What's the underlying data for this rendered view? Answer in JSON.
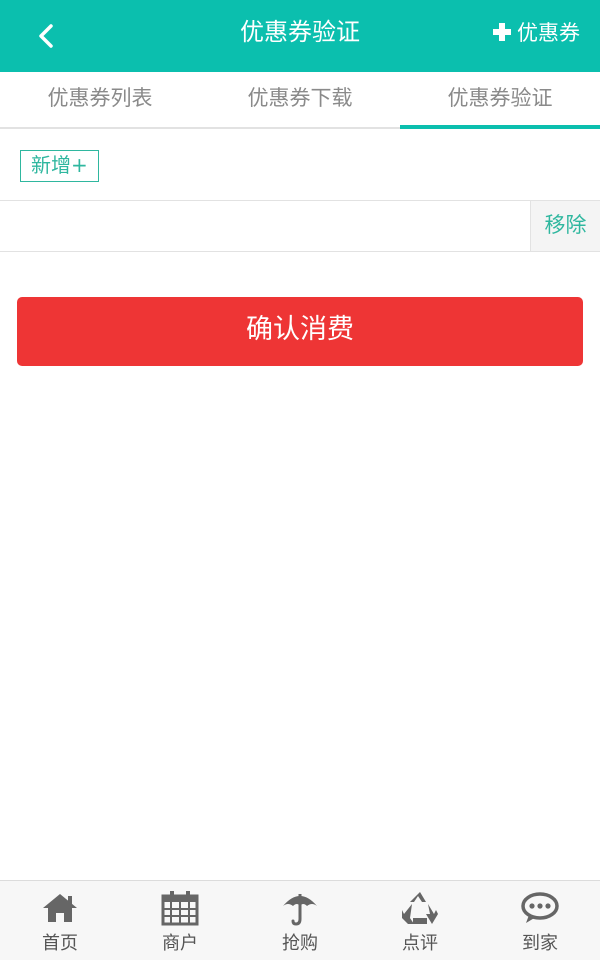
{
  "header": {
    "title": "优惠券验证",
    "action_label": "优惠券",
    "back_icon": "chevron-left-icon",
    "action_icon": "plus-icon",
    "color": "#0bbfae"
  },
  "tabs": [
    {
      "label": "优惠券列表",
      "active": false
    },
    {
      "label": "优惠券下载",
      "active": false
    },
    {
      "label": "优惠券验证",
      "active": true
    }
  ],
  "form": {
    "add_label": "新增+",
    "code_value": "",
    "remove_label": "移除",
    "confirm_label": "确认消费",
    "accent_color": "#2fb79f",
    "confirm_color": "#ee3535"
  },
  "bottom_nav": [
    {
      "label": "首页",
      "icon": "home-icon"
    },
    {
      "label": "商户",
      "icon": "calendar-icon"
    },
    {
      "label": "抢购",
      "icon": "umbrella-icon"
    },
    {
      "label": "点评",
      "icon": "recycle-icon"
    },
    {
      "label": "到家",
      "icon": "chat-bubble-icon"
    }
  ]
}
